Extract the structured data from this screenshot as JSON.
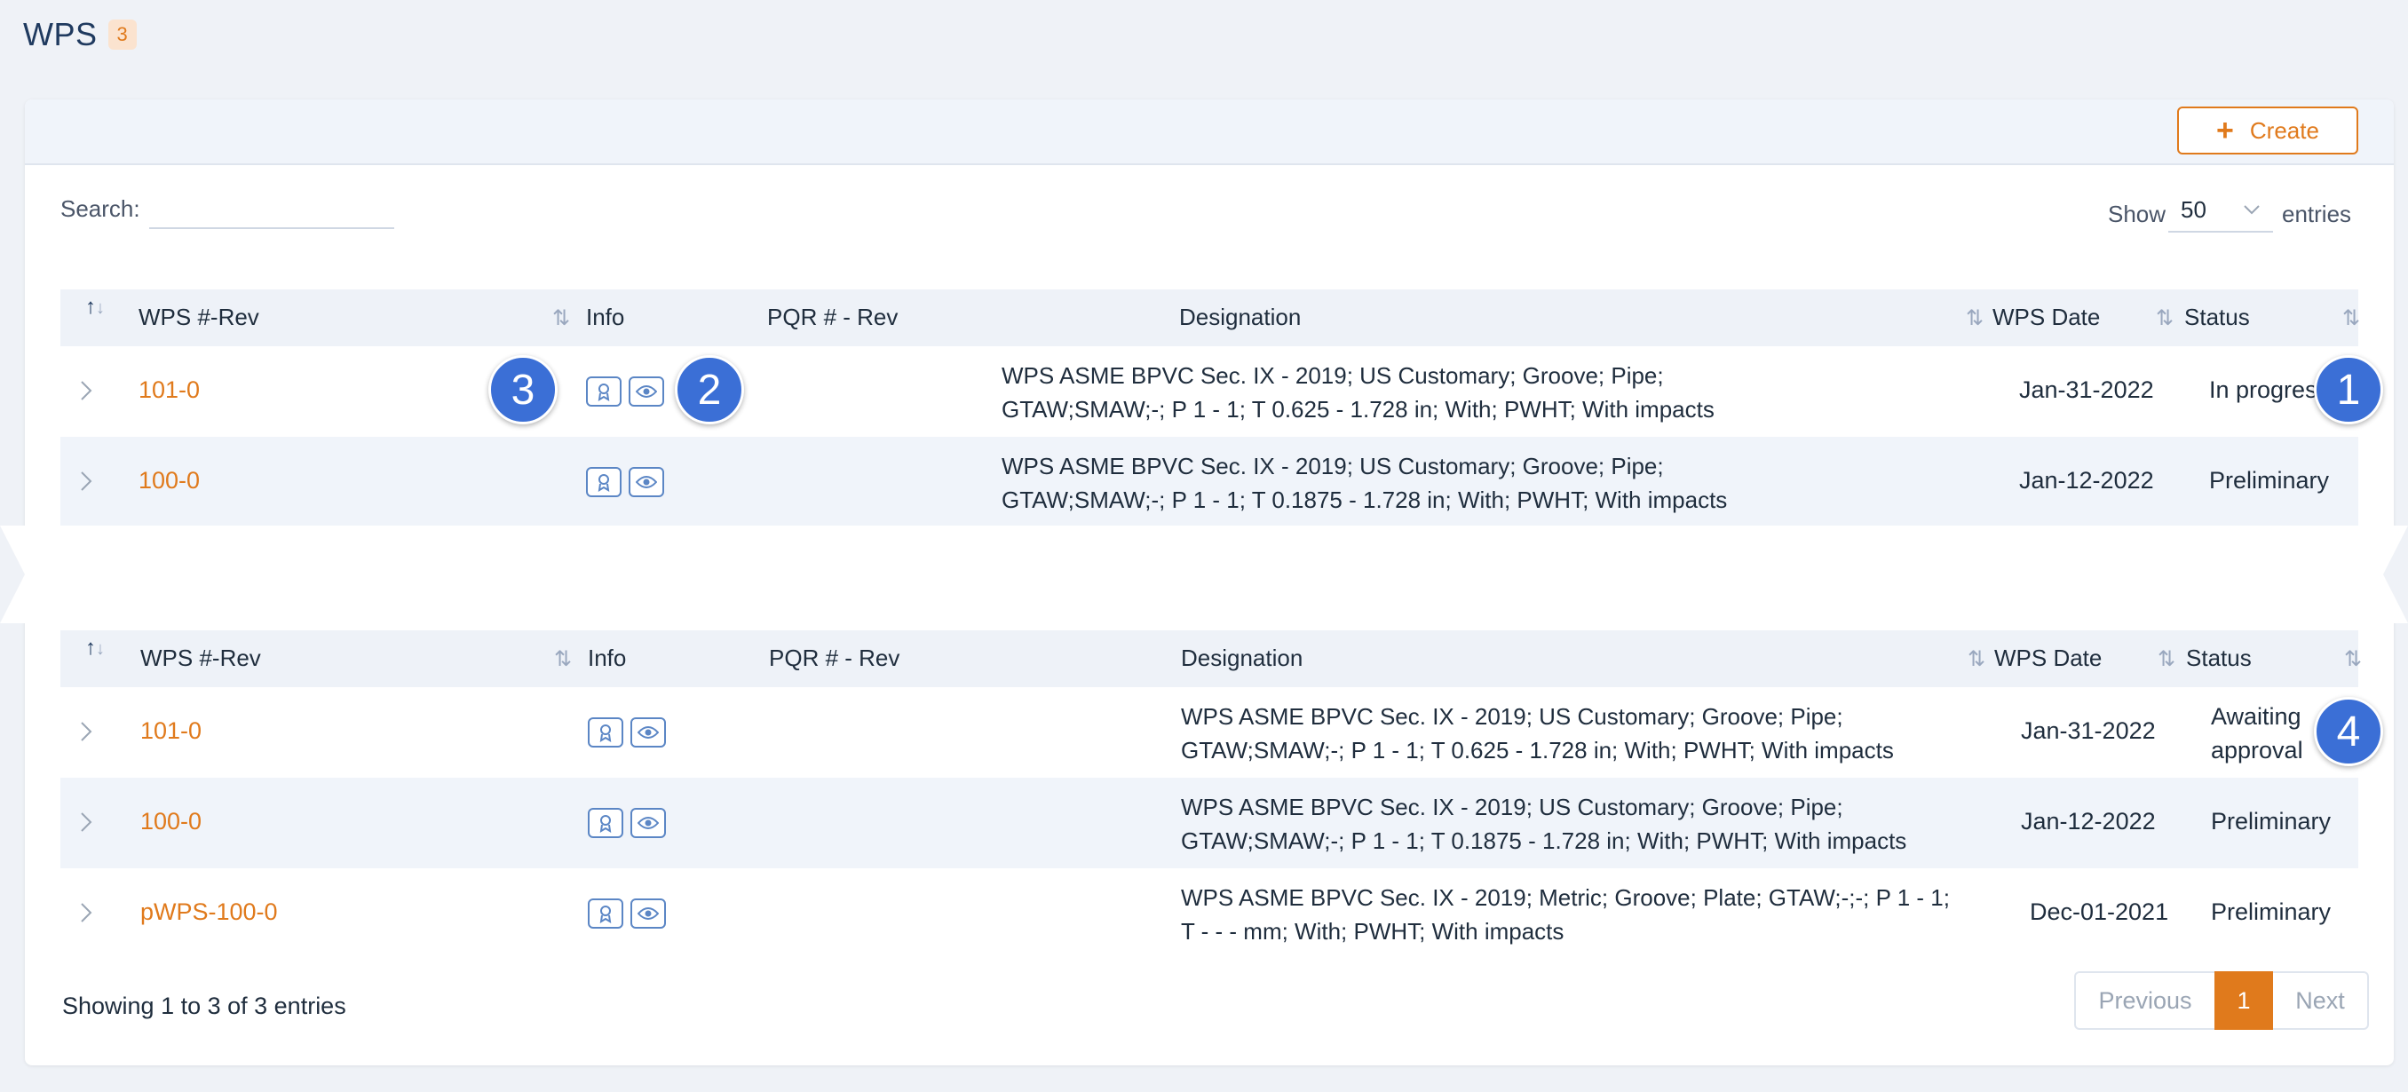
{
  "page": {
    "title": "WPS",
    "count": "3"
  },
  "toolbar": {
    "create_label": "Create",
    "create_icon": "plus-icon"
  },
  "controls": {
    "search_label": "Search:",
    "search_value": "",
    "show_label": "Show",
    "entries_value": "50",
    "entries_label": "entries"
  },
  "table": {
    "columns": [
      "WPS #-Rev",
      "Info",
      "PQR # - Rev",
      "Designation",
      "WPS Date",
      "Status"
    ]
  },
  "rows_top": [
    {
      "wps": "101-0",
      "designation_l1": "WPS ASME BPVC Sec. IX - 2019; US Customary; Groove; Pipe;",
      "designation_l2": "GTAW;SMAW;-; P 1 - 1; T 0.625 - 1.728 in; With; PWHT; With impacts",
      "date": "Jan-31-2022",
      "status": "In progress"
    },
    {
      "wps": "100-0",
      "designation_l1": "WPS ASME BPVC Sec. IX - 2019; US Customary; Groove; Pipe;",
      "designation_l2": "GTAW;SMAW;-; P 1 - 1; T 0.1875 - 1.728 in; With; PWHT; With impacts",
      "date": "Jan-12-2022",
      "status": "Preliminary"
    }
  ],
  "rows_bottom": [
    {
      "wps": "101-0",
      "designation_l1": "WPS ASME BPVC Sec. IX - 2019; US Customary; Groove; Pipe;",
      "designation_l2": "GTAW;SMAW;-; P 1 - 1; T 0.625 - 1.728 in; With; PWHT; With impacts",
      "date": "Jan-31-2022",
      "status_l1": "Awaiting",
      "status_l2": "approval"
    },
    {
      "wps": "100-0",
      "designation_l1": "WPS ASME BPVC Sec. IX - 2019; US Customary; Groove; Pipe;",
      "designation_l2": "GTAW;SMAW;-; P 1 - 1; T 0.1875 - 1.728 in; With; PWHT; With impacts",
      "date": "Jan-12-2022",
      "status": "Preliminary"
    },
    {
      "wps": "pWPS-100-0",
      "designation_l1": "WPS ASME BPVC Sec. IX - 2019; Metric; Groove; Plate; GTAW;-;-; P 1 - 1;",
      "designation_l2": "T - - - mm; With; PWHT; With impacts",
      "date": "Dec-01-2021",
      "status": "Preliminary"
    }
  ],
  "footer": {
    "info": "Showing 1 to 3 of 3 entries",
    "prev": "Previous",
    "current": "1",
    "next": "Next"
  },
  "callouts": [
    "1",
    "2",
    "3",
    "4"
  ],
  "colors": {
    "accent": "#e07a1c",
    "callout": "#3b6fd6",
    "header_bg": "#eef2f8"
  },
  "icons": {
    "row_info_1": "certificate-icon",
    "row_info_2": "eye-icon",
    "expand": "chevron-right-icon"
  }
}
